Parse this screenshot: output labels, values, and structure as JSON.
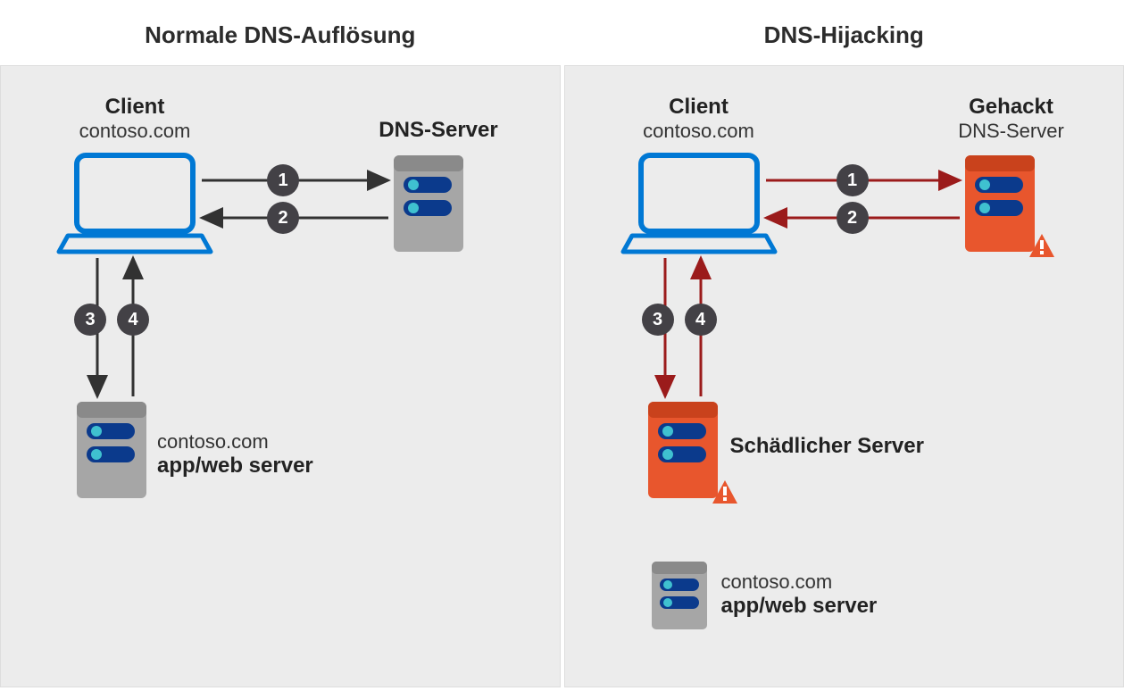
{
  "left": {
    "title": "Normale DNS-Auflösung",
    "client_bold": "Client",
    "client_sub": "contoso.com",
    "dns_bold": "DNS-Server",
    "server_reg": "contoso.com",
    "server_bold": "app/web server",
    "steps": {
      "s1": "1",
      "s2": "2",
      "s3": "3",
      "s4": "4"
    }
  },
  "right": {
    "title": "DNS-Hijacking",
    "client_bold": "Client",
    "client_sub": "contoso.com",
    "dns_bold": "Gehackt",
    "dns_sub": "DNS-Server",
    "malicious": "Schädlicher Server",
    "server_reg": "contoso.com",
    "server_bold": "app/web server",
    "steps": {
      "s1": "1",
      "s2": "2",
      "s3": "3",
      "s4": "4"
    }
  },
  "colors": {
    "blue": "#0078d4",
    "darkblue": "#0b3a8c",
    "grayServer": "#a6a6a6",
    "orange": "#e8562d",
    "darkred": "#9b1b1b",
    "badge": "#434146",
    "cyan": "#3fc1d0"
  }
}
